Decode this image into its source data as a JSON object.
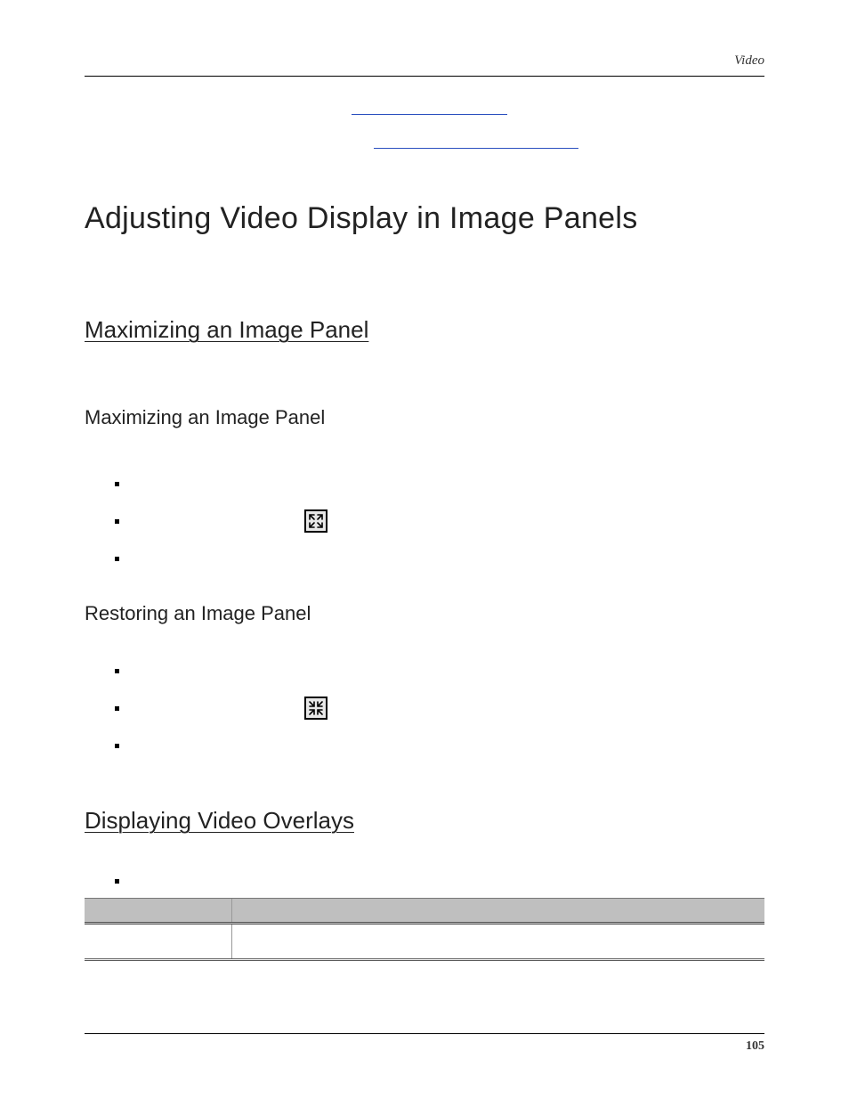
{
  "header": {
    "section": "Video"
  },
  "title": "Adjusting Video Display in Image Panels",
  "sections": {
    "maximizing": {
      "heading": "Maximizing an Image Panel",
      "sub1": "Maximizing an Image Panel",
      "sub2": "Restoring an Image Panel"
    },
    "overlays": {
      "heading": "Displaying Video Overlays"
    }
  },
  "icons": {
    "maximize": "maximize-icon",
    "restore": "restore-icon"
  },
  "footer": {
    "page_number": "105"
  }
}
